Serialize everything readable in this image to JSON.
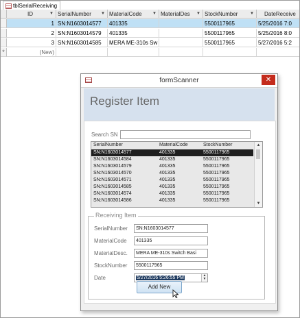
{
  "tab": {
    "label": "tblSerialReceiving"
  },
  "table": {
    "columns": [
      "ID",
      "SerialNumber",
      "MaterialCode",
      "MaterialDes",
      "StockNumber",
      "DateReceive"
    ],
    "rows": [
      {
        "id": "1",
        "serial": "SN:N1603014577",
        "material": "401335",
        "desc": "",
        "stock": "5500117965",
        "date": "5/25/2016 7:0"
      },
      {
        "id": "2",
        "serial": "SN:N1603014579",
        "material": "401335",
        "desc": "",
        "stock": "5500117965",
        "date": "5/25/2016 8:0"
      },
      {
        "id": "3",
        "serial": "SN:N1603014585",
        "material": "MERA ME-310s Sw",
        "desc": "",
        "stock": "5500117965",
        "date": "5/27/2016 5:2"
      }
    ],
    "new_row": {
      "marker": "*",
      "label": "(New)"
    }
  },
  "form": {
    "window_title": "formScanner",
    "close_glyph": "✕",
    "header_title": "Register Item",
    "search_label": "Search SN",
    "search_value": "",
    "list": {
      "headers": [
        "SerialNumber",
        "MaterialCode",
        "StockNumber"
      ],
      "rows": [
        {
          "serial": "SN:N1603014577",
          "material": "401335",
          "stock": "5500117965"
        },
        {
          "serial": "SN:N1603014584",
          "material": "401335",
          "stock": "5500117965"
        },
        {
          "serial": "SN:N1603014579",
          "material": "401335",
          "stock": "5500117965"
        },
        {
          "serial": "SN:N1603014570",
          "material": "401335",
          "stock": "5500117965"
        },
        {
          "serial": "SN:N1603014571",
          "material": "401335",
          "stock": "5500117965"
        },
        {
          "serial": "SN:N1603014585",
          "material": "401335",
          "stock": "5500117965"
        },
        {
          "serial": "SN:N1603014574",
          "material": "401335",
          "stock": "5500117965"
        },
        {
          "serial": "SN:N1603014586",
          "material": "401335",
          "stock": "5500117965"
        }
      ]
    },
    "receiving": {
      "legend": "Receiving Item",
      "serial_label": "SerialNumber",
      "serial_value": "SN:N1603014577",
      "material_label": "MaterialCode",
      "material_value": "401335",
      "desc_label": "MaterialDesc.",
      "desc_value": "MERA ME-310s Switch Basi",
      "stock_label": "StockNumber",
      "stock_value": "5500117965",
      "date_label": "Date",
      "date_value": "5/27/2016 5:26:55 PM"
    },
    "add_button": "Add New"
  },
  "colors": {
    "selected_row": "#bfe0f5",
    "close_button": "#c42b1c",
    "header_band": "#d6e1ee",
    "list_highlight": "#1f1f1f"
  }
}
